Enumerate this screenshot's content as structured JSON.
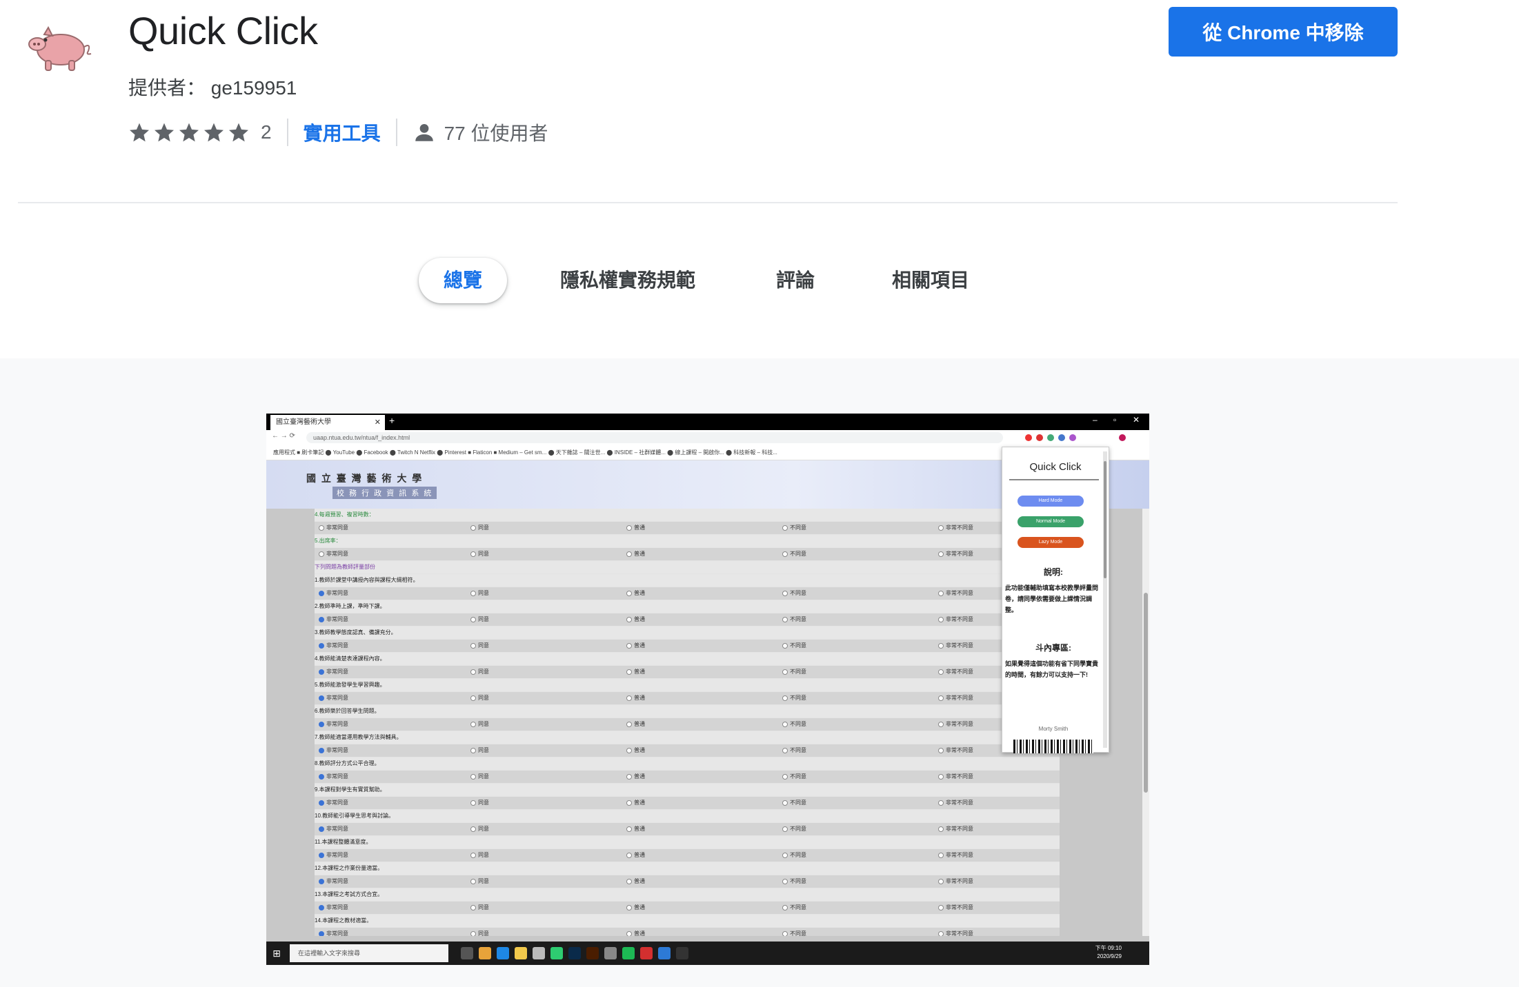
{
  "extension": {
    "name": "Quick Click",
    "offered_by": "提供者：  ge159951",
    "rating_count": "2",
    "stars": 5,
    "category": "實用工具",
    "users": "77 位使用者",
    "remove_button": "從 Chrome 中移除"
  },
  "tabs": [
    {
      "label": "總覽",
      "active": true
    },
    {
      "label": "隱私權實務規範",
      "active": false
    },
    {
      "label": "評論",
      "active": false
    },
    {
      "label": "相關項目",
      "active": false
    }
  ],
  "screenshot": {
    "browser_tab": "國立臺灣藝術大學",
    "url": "uaap.ntua.edu.tw/ntua/f_index.html",
    "bookmarks": "應用程式    ■ 刷卡筆記    ⬤ YouTube    ⬤ Facebook    ⬤ Twitch    N Netflix    ⬤ Pinterest    ■ Flaticon    ■ Medium – Get sm...    ⬤ 天下雜誌 – 關注世...    ⬤ INSIDE – 社群媒體...    ⬤ 線上課程 – 開啟你...    ⬤ 科技新報 – 科技...",
    "school_name": "國 立 臺 灣 藝 術 大 學",
    "system_name": "校 務 行 政 資 訊 系 統",
    "popup": {
      "title": "Quick Click",
      "buttons": [
        {
          "label": "Hard Mode",
          "color": "#6d8cf0"
        },
        {
          "label": "Normal Mode",
          "color": "#3aa26a"
        },
        {
          "label": "Lazy Mode",
          "color": "#d9541e"
        }
      ],
      "desc_title": "說明:",
      "desc_text": "此功能僅輔助填寫本校教學評量問卷，請同學依需要做上課情況調整。",
      "donate_title": "斗內專區:",
      "donate_text": "如果覺得這個功能有省下同學寶貴的時間，有餘力可以支持一下!",
      "author": "Morty Smith"
    },
    "options": [
      "非常同意",
      "同意",
      "普通",
      "不同意",
      "非常不同意"
    ],
    "questions": [
      "4.每週預習、複習時數：",
      "5.出席率：",
      "下列問題為教師評量部份",
      "1.教師於課堂中講授內容與課程大綱相符。",
      "2.教師準時上課，準時下課。",
      "3.教師教學態度認真、備課充分。",
      "4.教師能清楚表達課程內容。",
      "5.教師能激發學生學習興趣。",
      "6.教師樂於回答學生問題。",
      "7.教師能適當運用教學方法與輔具。",
      "8.教師評分方式公平合理。",
      "9.本課程對學生有實質幫助。",
      "10.教師能引導學生思考與討論。",
      "11.本課程整體滿意度。",
      "12.本課程之作業份量適當。",
      "13.本課程之考試方式合宜。",
      "14.本課程之教材適當。"
    ],
    "taskbar_search": "在這裡輸入文字來搜尋",
    "clock_time": "下午 09:10",
    "clock_date": "2020/9/29"
  }
}
